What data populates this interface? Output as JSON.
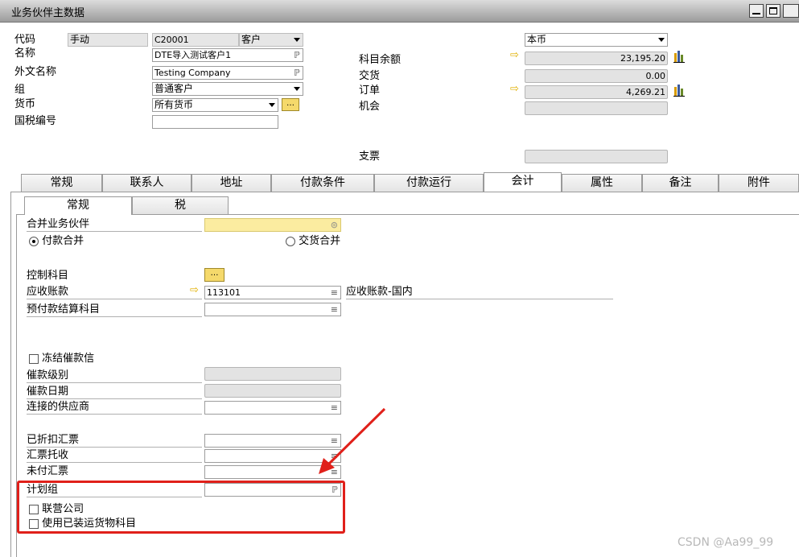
{
  "window": {
    "title": "业务伙伴主数据"
  },
  "header": {
    "code_label": "代码",
    "code_mode": "手动",
    "code_value": "C20001",
    "type_value": "客户",
    "name_label": "名称",
    "name_value": "DTE导入测试客户1",
    "foreign_name_label": "外文名称",
    "foreign_name_value": "Testing Company",
    "group_label": "组",
    "group_value": "普通客户",
    "currency_label": "货币",
    "currency_value": "所有货币",
    "tax_label": "国税编号",
    "tax_value": "",
    "currency_select": "本币",
    "balance_label": "科目余额",
    "balance_value": "23,195.20",
    "delivery_label": "交货",
    "delivery_value": "0.00",
    "order_label": "订单",
    "order_value": "4,269.21",
    "opportunity_label": "机会",
    "check_label": "支票"
  },
  "tabs": [
    "常规",
    "联系人",
    "地址",
    "付款条件",
    "付款运行",
    "会计",
    "属性",
    "备注",
    "附件"
  ],
  "subtabs": [
    "常规",
    "税"
  ],
  "accounting": {
    "consolidating_bp_label": "合并业务伙伴",
    "consolidating_bp_value": "",
    "payment_consolidation": "付款合并",
    "delivery_consolidation": "交货合并",
    "control_account_label": "控制科目",
    "ar_label": "应收账款",
    "ar_code": "113101",
    "ar_name": "应收账款-国内",
    "down_payment_label": "预付款结算科目",
    "block_dunning_label": "冻结催款信",
    "dunning_level_label": "催款级别",
    "dunning_date_label": "催款日期",
    "connected_vendor_label": "连接的供应商",
    "discounted_bills_label": "已折扣汇票",
    "bills_collection_label": "汇票托收",
    "unpaid_bills_label": "未付汇票",
    "planning_group_label": "计划组",
    "affiliate_label": "联营公司",
    "shipped_goods_label": "使用已装运货物科目"
  },
  "watermark": "CSDN @Aa99_99",
  "colors": {
    "highlight_box": "#e0201a",
    "active_field": "#fbeca0"
  }
}
